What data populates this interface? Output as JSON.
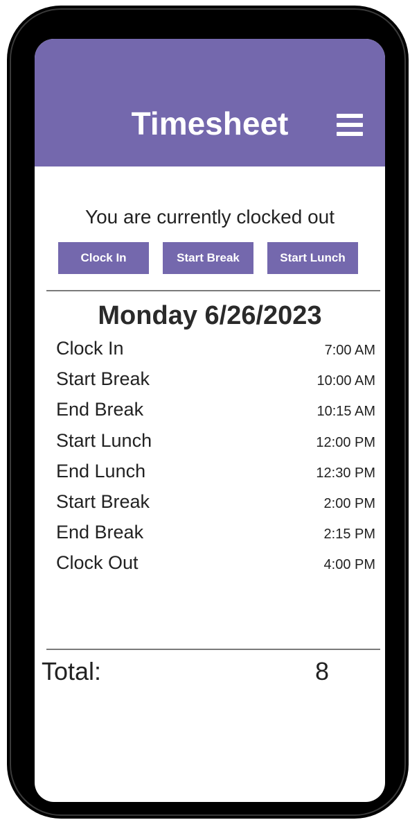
{
  "header": {
    "title": "Timesheet",
    "menu_icon": "hamburger-menu-icon",
    "background_color": "#7468ad"
  },
  "status": {
    "text": "You are currently clocked out"
  },
  "actions": [
    {
      "label": "Clock In"
    },
    {
      "label": "Start Break"
    },
    {
      "label": "Start Lunch"
    }
  ],
  "day": {
    "heading": "Monday 6/26/2023",
    "entries": [
      {
        "label": "Clock In",
        "time": "7:00 AM"
      },
      {
        "label": "Start Break",
        "time": "10:00 AM"
      },
      {
        "label": "End Break",
        "time": "10:15 AM"
      },
      {
        "label": "Start Lunch",
        "time": "12:00 PM"
      },
      {
        "label": "End Lunch",
        "time": "12:30 PM"
      },
      {
        "label": "Start Break",
        "time": "2:00 PM"
      },
      {
        "label": "End Break",
        "time": "2:15 PM"
      },
      {
        "label": "Clock Out",
        "time": "4:00 PM"
      }
    ]
  },
  "total": {
    "label": "Total:",
    "value": "8"
  }
}
